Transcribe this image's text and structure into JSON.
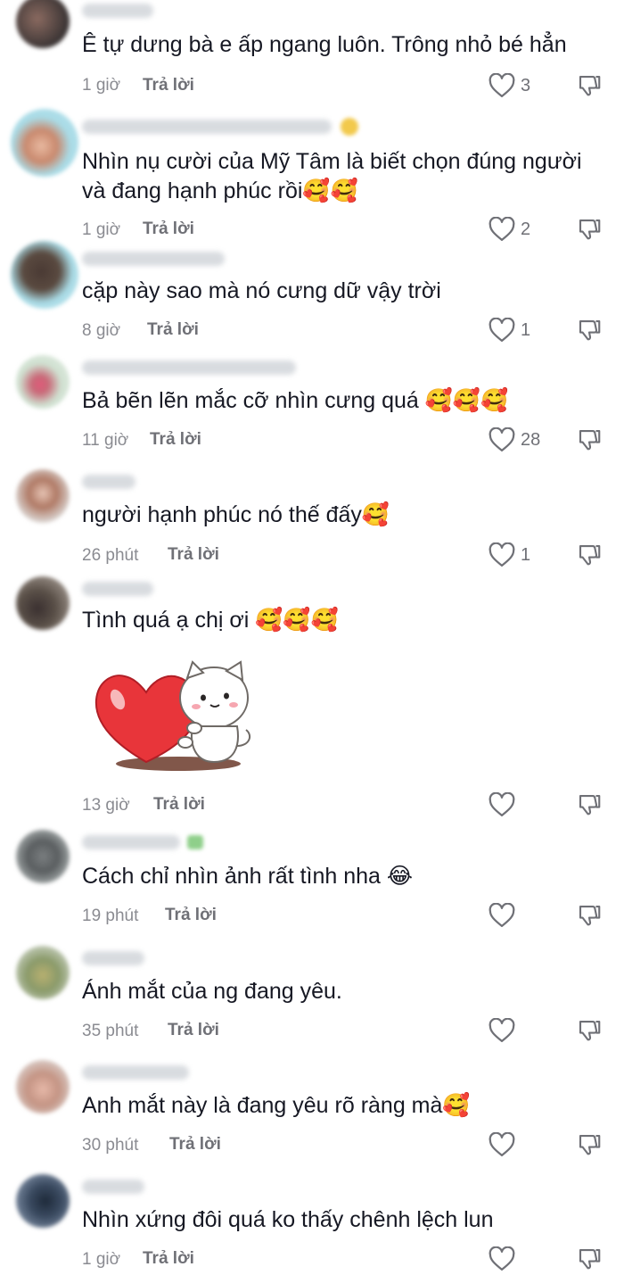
{
  "reply_label": "Trả lời",
  "comments": [
    {
      "text": "Ê tự dưng bà e ấp ngang luôn. Trông nhỏ bé hẳn",
      "time": "1 giờ",
      "likes": "3"
    },
    {
      "text": "Nhìn nụ cười của Mỹ Tâm là biết chọn đúng người và đang hạnh phúc rồi🥰🥰",
      "time": "1 giờ",
      "likes": "2"
    },
    {
      "text": "cặp này sao mà nó cưng dữ vậy trời",
      "time": "8 giờ",
      "likes": "1"
    },
    {
      "text": "Bả bẽn lẽn mắc cỡ nhìn cưng quá 🥰🥰🥰",
      "time": "11 giờ",
      "likes": "28"
    },
    {
      "text": "người hạnh phúc nó thế đấy🥰",
      "time": "26 phút",
      "likes": "1"
    },
    {
      "text": "Tình quá ạ chị ơi 🥰🥰🥰",
      "time": "13 giờ",
      "likes": ""
    },
    {
      "text": "Cách chỉ nhìn ảnh rất tình nha 😂",
      "time": "19 phút",
      "likes": ""
    },
    {
      "text": "Ánh mắt của ng đang yêu.",
      "time": "35 phút",
      "likes": ""
    },
    {
      "text": "Anh mắt này là đang yêu rõ ràng mà🥰",
      "time": "30 phút",
      "likes": ""
    },
    {
      "text": "Nhìn xứng đôi quá ko thấy chênh lệch lun",
      "time": "1 giờ",
      "likes": ""
    }
  ],
  "icons": {
    "like": "heart-outline-icon",
    "dislike": "thumbs-down-icon",
    "sticker": "cat-holding-heart-sticker"
  },
  "colors": {
    "text": "#161823",
    "meta": "#8a8b91",
    "icon": "#6f7076"
  }
}
